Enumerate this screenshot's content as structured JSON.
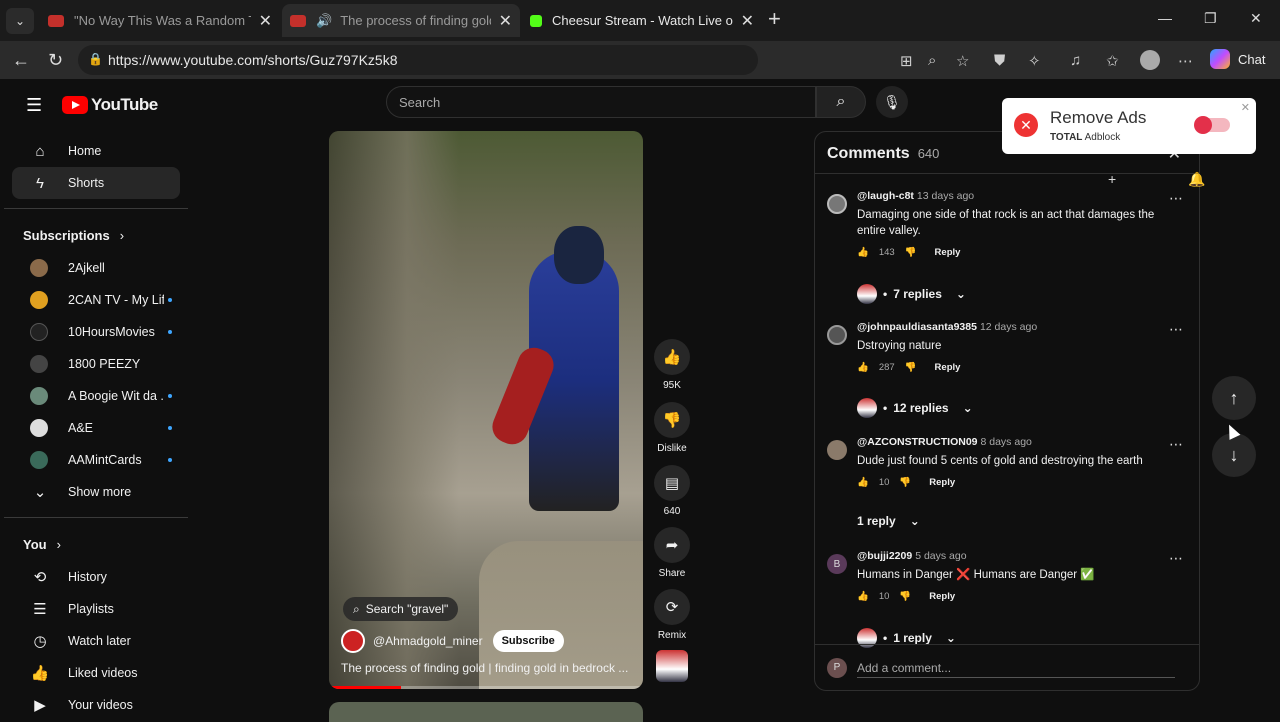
{
  "browser": {
    "tabs": [
      {
        "title": "\"No Way This Was a Random Traff",
        "favicon_color": "#c4302b"
      },
      {
        "title": "The process of finding gold | fi",
        "favicon_color": "#c4302b"
      },
      {
        "title": "Cheesur Stream - Watch Live on Ki",
        "favicon_color": "#53fc18"
      }
    ],
    "url": "https://www.youtube.com/shorts/Guz797Kz5k8",
    "chat_label": "Chat"
  },
  "youtube": {
    "logo_text": "YouTube",
    "search_placeholder": "Search",
    "sidebar": {
      "main": [
        {
          "label": "Home",
          "icon": "home-icon"
        },
        {
          "label": "Shorts",
          "icon": "shorts-icon"
        }
      ],
      "subscriptions_heading": "Subscriptions",
      "subscriptions": [
        {
          "name": "2Ajkell",
          "color": "#8a6a4a",
          "dot": false
        },
        {
          "name": "2CAN TV - My Lif...",
          "color": "#e0a020",
          "dot": true
        },
        {
          "name": "10HoursMovies",
          "color": "#222222",
          "dot": true
        },
        {
          "name": "1800 PEEZY",
          "color": "#444444",
          "dot": false
        },
        {
          "name": "A Boogie Wit da ...",
          "color": "#6a8a7a",
          "dot": true
        },
        {
          "name": "A&E",
          "color": "#dddddd",
          "dot": true
        },
        {
          "name": "AAMintCards",
          "color": "#3a6a5a",
          "dot": true
        }
      ],
      "show_more": "Show more",
      "you_heading": "You",
      "you_items": [
        {
          "label": "History",
          "icon": "history-icon"
        },
        {
          "label": "Playlists",
          "icon": "playlists-icon"
        },
        {
          "label": "Watch later",
          "icon": "watch-later-icon"
        },
        {
          "label": "Liked videos",
          "icon": "liked-videos-icon"
        },
        {
          "label": "Your videos",
          "icon": "your-videos-icon"
        }
      ]
    },
    "short": {
      "search_chip": "Search \"gravel\"",
      "channel": "@Ahmadgold_miner",
      "subscribe": "Subscribe",
      "title": "The process of finding gold | finding gold in bedrock ...",
      "progress_fraction": 0.23,
      "actions": [
        {
          "icon": "like-icon",
          "label": "95K"
        },
        {
          "icon": "dislike-icon",
          "label": "Dislike"
        },
        {
          "icon": "comment-icon",
          "label": "640"
        },
        {
          "icon": "share-icon",
          "label": "Share"
        },
        {
          "icon": "remix-icon",
          "label": "Remix"
        }
      ]
    },
    "comments": {
      "heading": "Comments",
      "count": "640",
      "items": [
        {
          "user": "@laugh-c8t",
          "ago": "13 days ago",
          "text": "Damaging one side of that rock is an act that damages the entire valley.",
          "likes": "143",
          "replies": "7 replies",
          "avatar_color": "#777"
        },
        {
          "user": "@johnpauldiasanta9385",
          "ago": "12 days ago",
          "text": "Dstroying nature",
          "likes": "287",
          "replies": "12 replies",
          "avatar_color": "#555"
        },
        {
          "user": "@AZCONSTRUCTION09",
          "ago": "8 days ago",
          "text": "Dude just found 5 cents of gold and destroying the earth",
          "likes": "10",
          "replies": "1 reply",
          "avatar_color": "#8a7a6a"
        },
        {
          "user": "@bujji2209",
          "ago": "5 days ago",
          "text": "Humans in Danger ❌ Humans are Danger ✅",
          "likes": "10",
          "replies": "1 reply",
          "avatar_color": "#5a3a5a",
          "initial": "B"
        }
      ],
      "reply_label": "Reply",
      "add_placeholder": "Add a comment...",
      "user_initial": "P"
    },
    "adblock": {
      "title": "Remove Ads",
      "brand_bold": "TOTAL",
      "brand_rest": " Adblock"
    }
  }
}
